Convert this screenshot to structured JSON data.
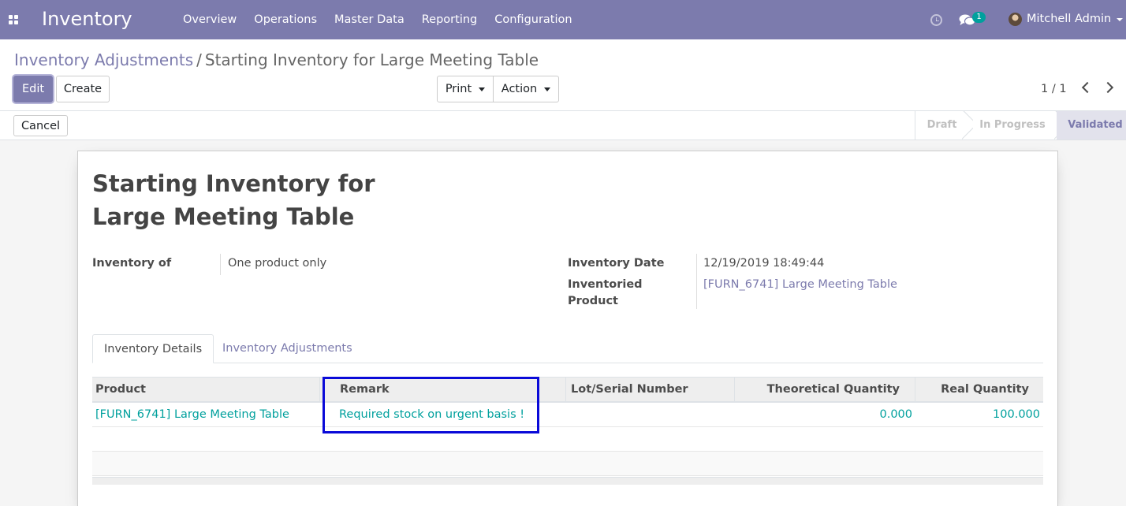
{
  "nav": {
    "app_title": "Inventory",
    "menu": [
      "Overview",
      "Operations",
      "Master Data",
      "Reporting",
      "Configuration"
    ],
    "chat_count": "1",
    "user_name": "Mitchell Admin"
  },
  "breadcrumb": {
    "parent": "Inventory Adjustments",
    "separator": "/",
    "current": "Starting Inventory for Large Meeting Table"
  },
  "toolbar": {
    "edit_label": "Edit",
    "create_label": "Create",
    "print_label": "Print",
    "action_label": "Action",
    "pager": "1 / 1"
  },
  "statusbar": {
    "cancel_label": "Cancel",
    "stages": [
      "Draft",
      "In Progress",
      "Validated"
    ],
    "current_stage": "Validated"
  },
  "form": {
    "title_line1": "Starting Inventory for",
    "title_line2": "Large Meeting Table",
    "inventory_of_label": "Inventory of",
    "inventory_of_value": "One product only",
    "inventory_date_label": "Inventory Date",
    "inventory_date_value": "12/19/2019 18:49:44",
    "inventoried_product_label_1": "Inventoried",
    "inventoried_product_label_2": "Product",
    "inventoried_product_value": "[FURN_6741] Large Meeting Table"
  },
  "tabs": [
    "Inventory Details",
    "Inventory Adjustments"
  ],
  "table": {
    "columns": [
      "Product",
      "Remark",
      "Lot/Serial Number",
      "Theoretical Quantity",
      "Real Quantity"
    ],
    "rows": [
      {
        "product": "[FURN_6741] Large Meeting Table",
        "remark": "Required stock on urgent basis !",
        "lot": "",
        "theoretical_qty": "0.000",
        "real_qty": "100.000"
      }
    ]
  },
  "colors": {
    "brand": "#7c7bad",
    "link_teal": "#00a09d",
    "highlight_box": "#0a0ad8"
  }
}
